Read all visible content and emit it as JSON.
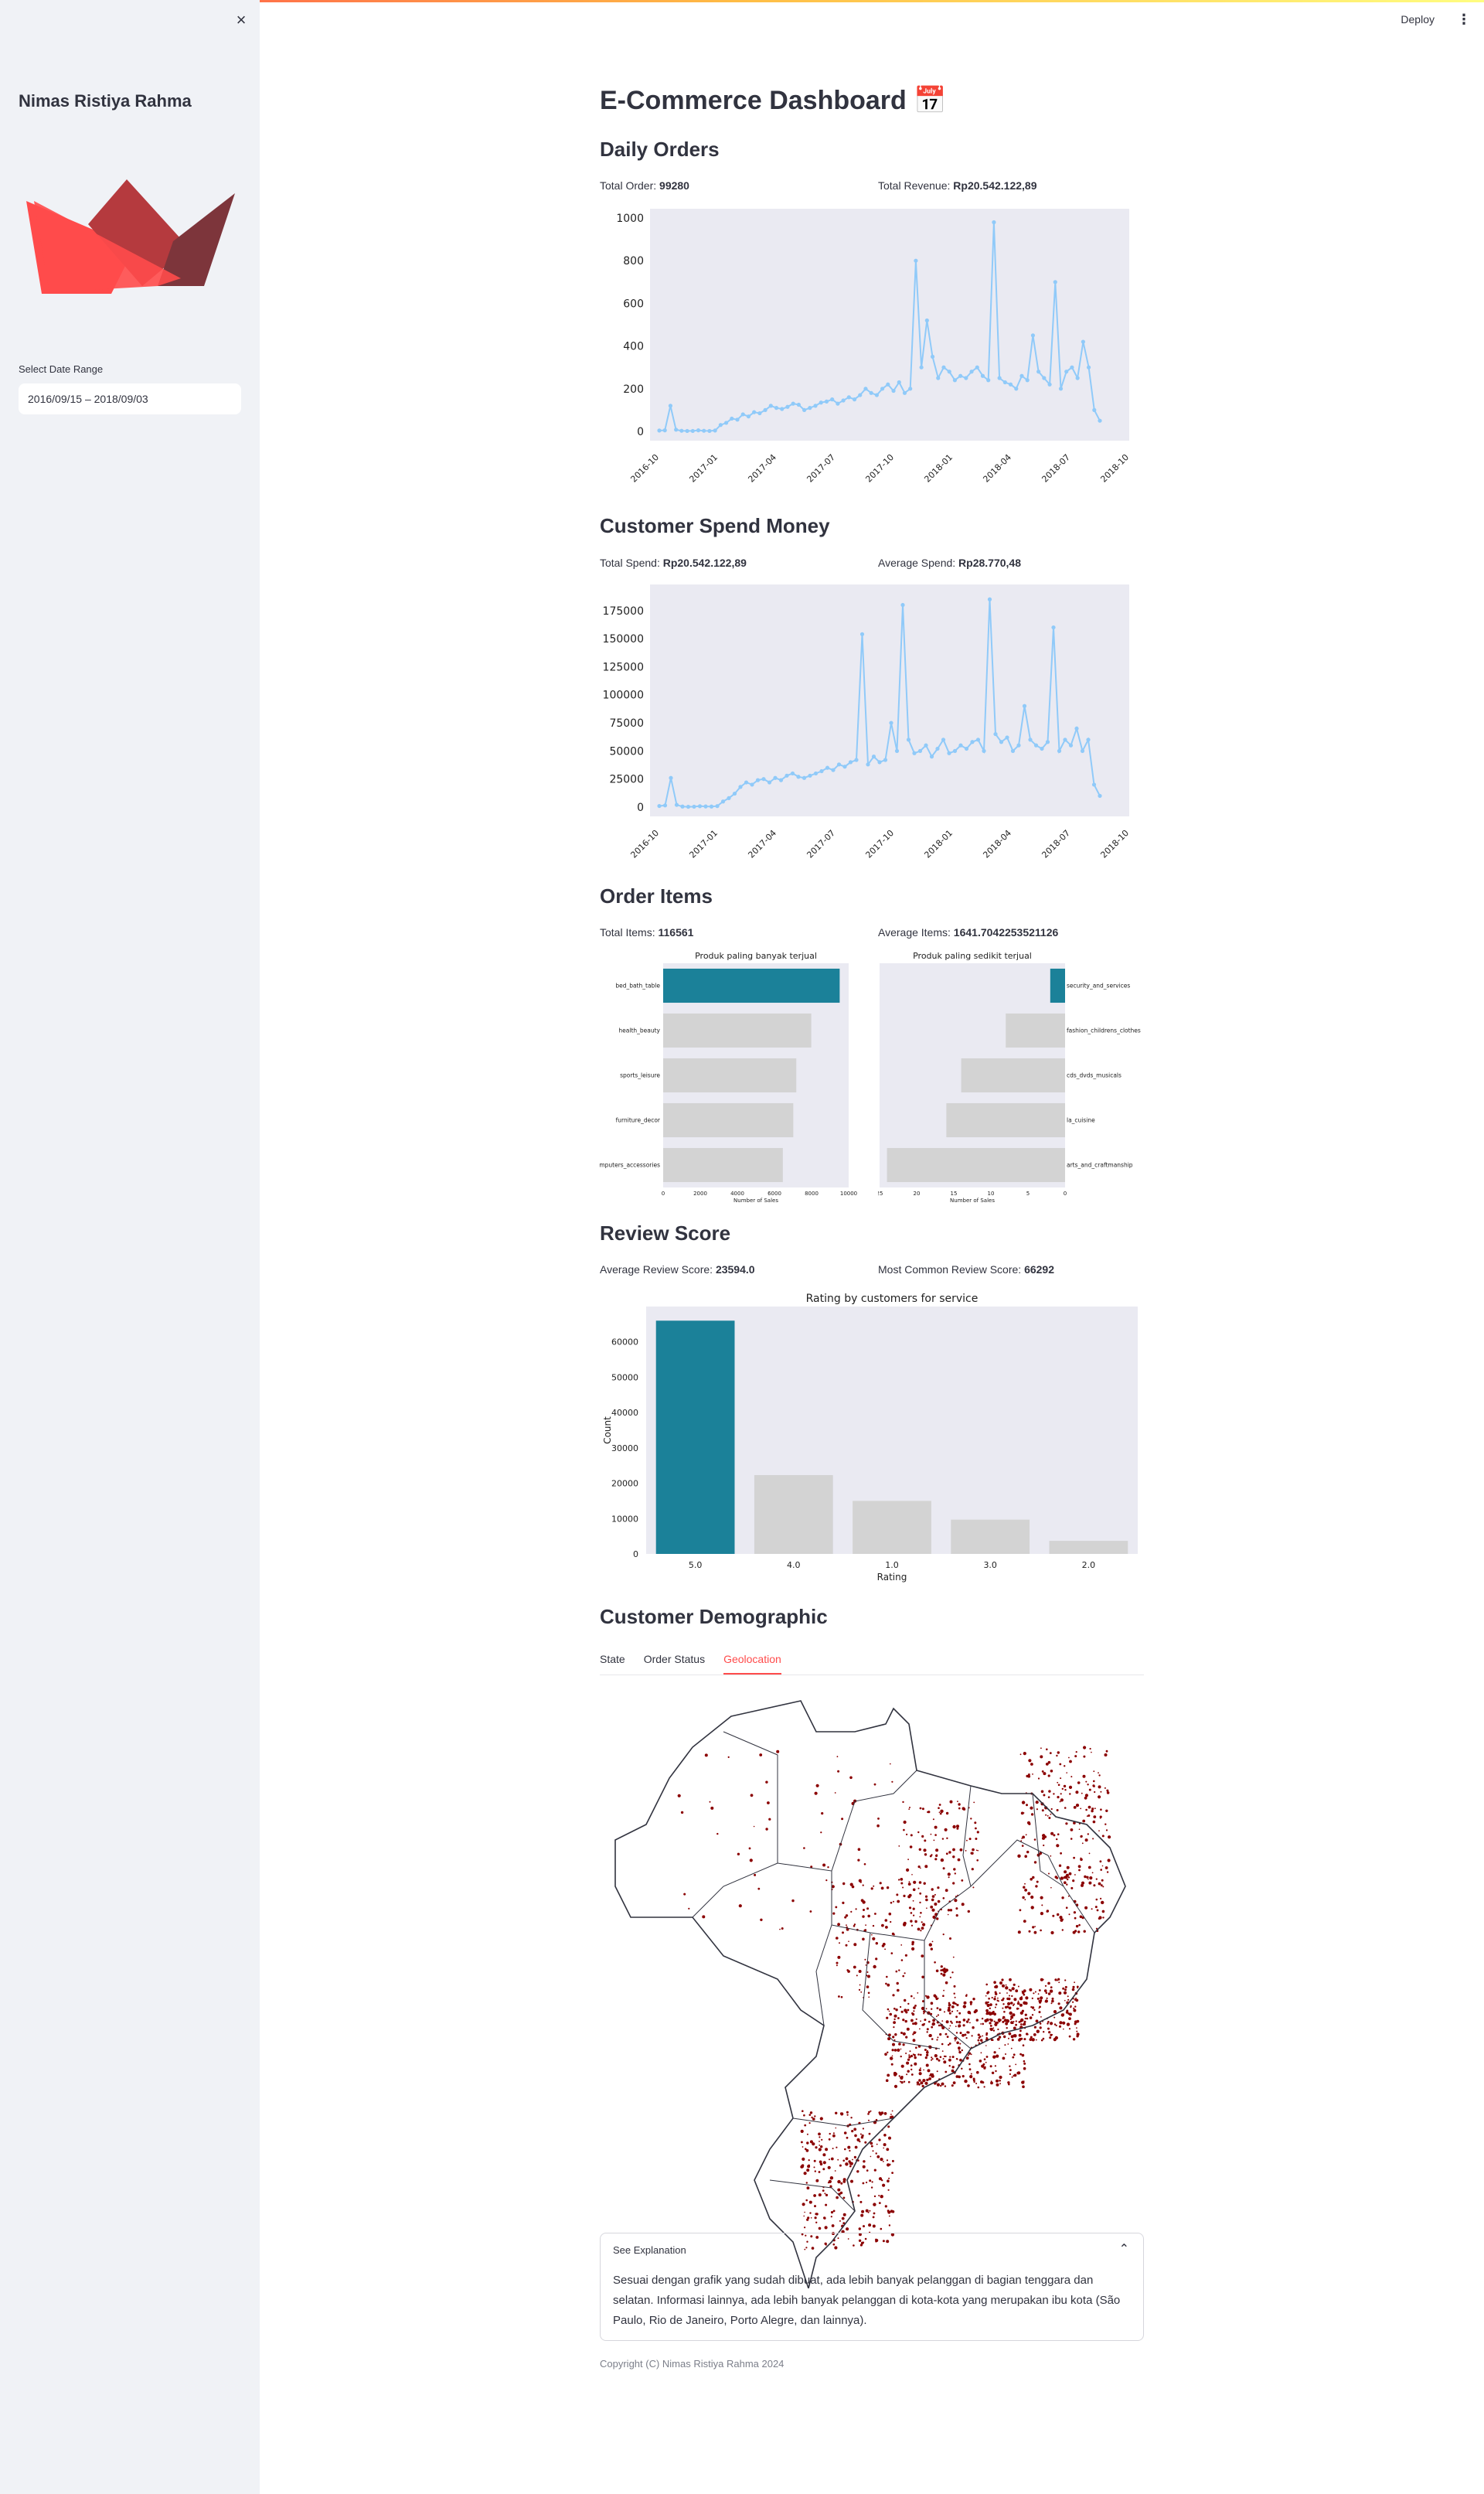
{
  "header": {
    "deploy_label": "Deploy",
    "menu_icon": "more-vertical-icon"
  },
  "sidebar": {
    "close_icon": "close-icon",
    "name": "Nimas Ristiya Rahma",
    "date_label": "Select Date Range",
    "date_value": "2016/09/15 – 2018/09/03"
  },
  "main": {
    "title": "E-Commerce Dashboard 📅",
    "daily_orders": {
      "heading": "Daily Orders",
      "metric1_label": "Total Order:",
      "metric1_value": "99280",
      "metric2_label": "Total Revenue:",
      "metric2_value": "Rp20.542.122,89"
    },
    "customer_spend": {
      "heading": "Customer Spend Money",
      "metric1_label": "Total Spend:",
      "metric1_value": "Rp20.542.122,89",
      "metric2_label": "Average Spend:",
      "metric2_value": "Rp28.770,48"
    },
    "order_items": {
      "heading": "Order Items",
      "metric1_label": "Total Items:",
      "metric1_value": "116561",
      "metric2_label": "Average Items:",
      "metric2_value": "1641.7042253521126"
    },
    "review_score": {
      "heading": "Review Score",
      "metric1_label": "Average Review Score:",
      "metric1_value": "23594.0",
      "metric2_label": "Most Common Review Score:",
      "metric2_value": "66292"
    },
    "demographic": {
      "heading": "Customer Demographic",
      "tabs": [
        "State",
        "Order Status",
        "Geolocation"
      ],
      "active_tab": 2
    },
    "expander": {
      "title": "See Explanation",
      "body": "Sesuai dengan grafik yang sudah dibuat, ada lebih banyak pelanggan di bagian tenggara dan selatan. Informasi lainnya, ada lebih banyak pelanggan di kota-kota yang merupakan ibu kota (São Paulo, Rio de Janeiro, Porto Alegre, dan lainnya)."
    },
    "copyright": "Copyright (C) Nimas Ristiya Rahma 2024"
  },
  "colors": {
    "accent": "#ff4b4b",
    "line": "#90caf9",
    "bar_highlight": "#1b8199",
    "bar_other": "#d3d3d3",
    "plot_bg": "#eaeaf2",
    "map_dots": "#8b0000"
  },
  "chart_data": [
    {
      "type": "line",
      "x_ticks": [
        "2016-10",
        "2017-01",
        "2017-04",
        "2017-07",
        "2017-10",
        "2018-01",
        "2018-04",
        "2018-07",
        "2018-10"
      ],
      "y_ticks": [
        0,
        200,
        400,
        600,
        800,
        1000
      ],
      "ylim": [
        0,
        1000
      ],
      "series": [
        {
          "values": [
            4,
            5,
            120,
            8,
            3,
            2,
            2,
            5,
            3,
            2,
            4,
            30,
            40,
            60,
            55,
            80,
            70,
            90,
            85,
            100,
            120,
            110,
            105,
            115,
            130,
            125,
            100,
            110,
            120,
            135,
            140,
            150,
            130,
            145,
            160,
            150,
            170,
            200,
            180,
            170,
            200,
            220,
            190,
            230,
            180,
            200,
            800,
            300,
            520,
            350,
            250,
            300,
            280,
            240,
            260,
            250,
            280,
            300,
            260,
            240,
            980,
            250,
            230,
            220,
            200,
            260,
            240,
            450,
            280,
            250,
            220,
            700,
            200,
            280,
            300,
            250,
            420,
            300,
            100,
            50
          ]
        }
      ]
    },
    {
      "type": "line",
      "x_ticks": [
        "2016-10",
        "2017-01",
        "2017-04",
        "2017-07",
        "2017-10",
        "2018-01",
        "2018-04",
        "2018-07",
        "2018-10"
      ],
      "y_ticks": [
        0,
        25000,
        50000,
        75000,
        100000,
        125000,
        150000,
        175000
      ],
      "ylim": [
        0,
        190000
      ],
      "series": [
        {
          "values": [
            1000,
            1500,
            26000,
            2000,
            500,
            300,
            400,
            800,
            600,
            500,
            900,
            5000,
            8000,
            12000,
            18000,
            22000,
            20000,
            24000,
            25000,
            22000,
            26000,
            24000,
            28000,
            30000,
            27000,
            26000,
            28000,
            30000,
            32000,
            35000,
            33000,
            38000,
            36000,
            40000,
            42000,
            154000,
            38000,
            45000,
            40000,
            42000,
            75000,
            50000,
            180000,
            60000,
            48000,
            50000,
            55000,
            45000,
            52000,
            60000,
            48000,
            50000,
            55000,
            52000,
            58000,
            60000,
            50000,
            185000,
            65000,
            58000,
            62000,
            50000,
            55000,
            90000,
            60000,
            55000,
            52000,
            58000,
            160000,
            50000,
            60000,
            55000,
            70000,
            50000,
            60000,
            20000,
            10000
          ]
        }
      ]
    },
    {
      "type": "bar",
      "title": "Produk paling banyak terjual",
      "categories": [
        "bed_bath_table",
        "health_beauty",
        "sports_leisure",
        "furniture_decor",
        "computers_accessories"
      ],
      "values": [
        11800,
        9900,
        8900,
        8700,
        8000
      ],
      "x_ticks": [
        0,
        2000,
        4000,
        6000,
        8000,
        10000
      ],
      "xlabel": "Number of Sales",
      "xlim": [
        0,
        12400
      ]
    },
    {
      "type": "bar",
      "title": "Produk paling sedikit terjual",
      "categories": [
        "security_and_services",
        "fashion_childrens_clothes",
        "cds_dvds_musicals",
        "la_cuisine",
        "arts_and_craftmanship"
      ],
      "values": [
        2,
        8,
        14,
        16,
        24
      ],
      "x_ticks": [
        25,
        20,
        15,
        10,
        5,
        0
      ],
      "xlabel": "Number of Sales",
      "xlim": [
        0,
        25
      ]
    },
    {
      "type": "bar",
      "title": "Rating by customers for service",
      "categories": [
        "5.0",
        "4.0",
        "1.0",
        "3.0",
        "2.0"
      ],
      "values": [
        66000,
        22300,
        15000,
        9700,
        3700
      ],
      "y_ticks": [
        0,
        10000,
        20000,
        30000,
        40000,
        50000,
        60000
      ],
      "xlabel": "Rating",
      "ylabel": "Count",
      "ylim": [
        0,
        70000
      ]
    }
  ]
}
